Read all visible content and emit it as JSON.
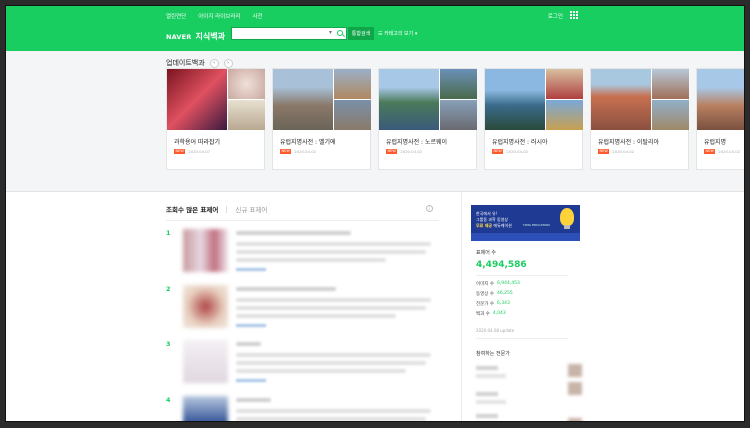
{
  "topbar": {
    "links": [
      "열린연단",
      "아이지 라이브러리",
      "사전"
    ],
    "login": "로그인",
    "brand": "NAVER",
    "service": "지식백과",
    "search_placeholder": "",
    "search_button": "통합검색",
    "category_link": "☰ 카테고리 보기 ▾"
  },
  "update": {
    "title": "업데이트백과",
    "prev": "‹",
    "next": "›",
    "cards": [
      {
        "title": "과학용어 따라잡기",
        "badge": "NEW",
        "date": "2020.04.07"
      },
      {
        "title": "유럽지명사전 : 벨기에",
        "badge": "NEW",
        "date": "2020.04.02"
      },
      {
        "title": "유럽지명사전 : 노르웨이",
        "badge": "NEW",
        "date": "2020.04.02"
      },
      {
        "title": "유럽지명사전 : 러시아",
        "badge": "NEW",
        "date": "2020.04.02"
      },
      {
        "title": "유럽지명사전 : 이탈리아",
        "badge": "NEW",
        "date": "2020.04.02"
      },
      {
        "title": "유럽지명",
        "badge": "NEW",
        "date": "2020.04.02"
      }
    ]
  },
  "rankings": {
    "tab_active": "조회수 많은 표제어",
    "tab_other": "신규 표제어",
    "info": "i",
    "ranks": [
      "1",
      "2",
      "3",
      "4"
    ]
  },
  "sidebar": {
    "banner_line1": "한국에서 유!",
    "banner_line2": "그룹동 과학 동영상",
    "banner_line3": "무료 제공",
    "banner_line4": "에듀케이션",
    "banner_logo": "TWIG EDUCATION",
    "count_title": "표제어 수",
    "count_value": "4,494,586",
    "stats": [
      {
        "label": "이미지 수",
        "value": "6,944,453"
      },
      {
        "label": "동영상 수",
        "value": "46,255"
      },
      {
        "label": "전문가 수",
        "value": "6,343"
      },
      {
        "label": "백과 수",
        "value": "4,043"
      }
    ],
    "update_note": "2020.04.08 update",
    "experts_title": "참여하는 전문가"
  },
  "colors": {
    "accent": "#19ce60",
    "new_badge": "#ff5a2c"
  }
}
